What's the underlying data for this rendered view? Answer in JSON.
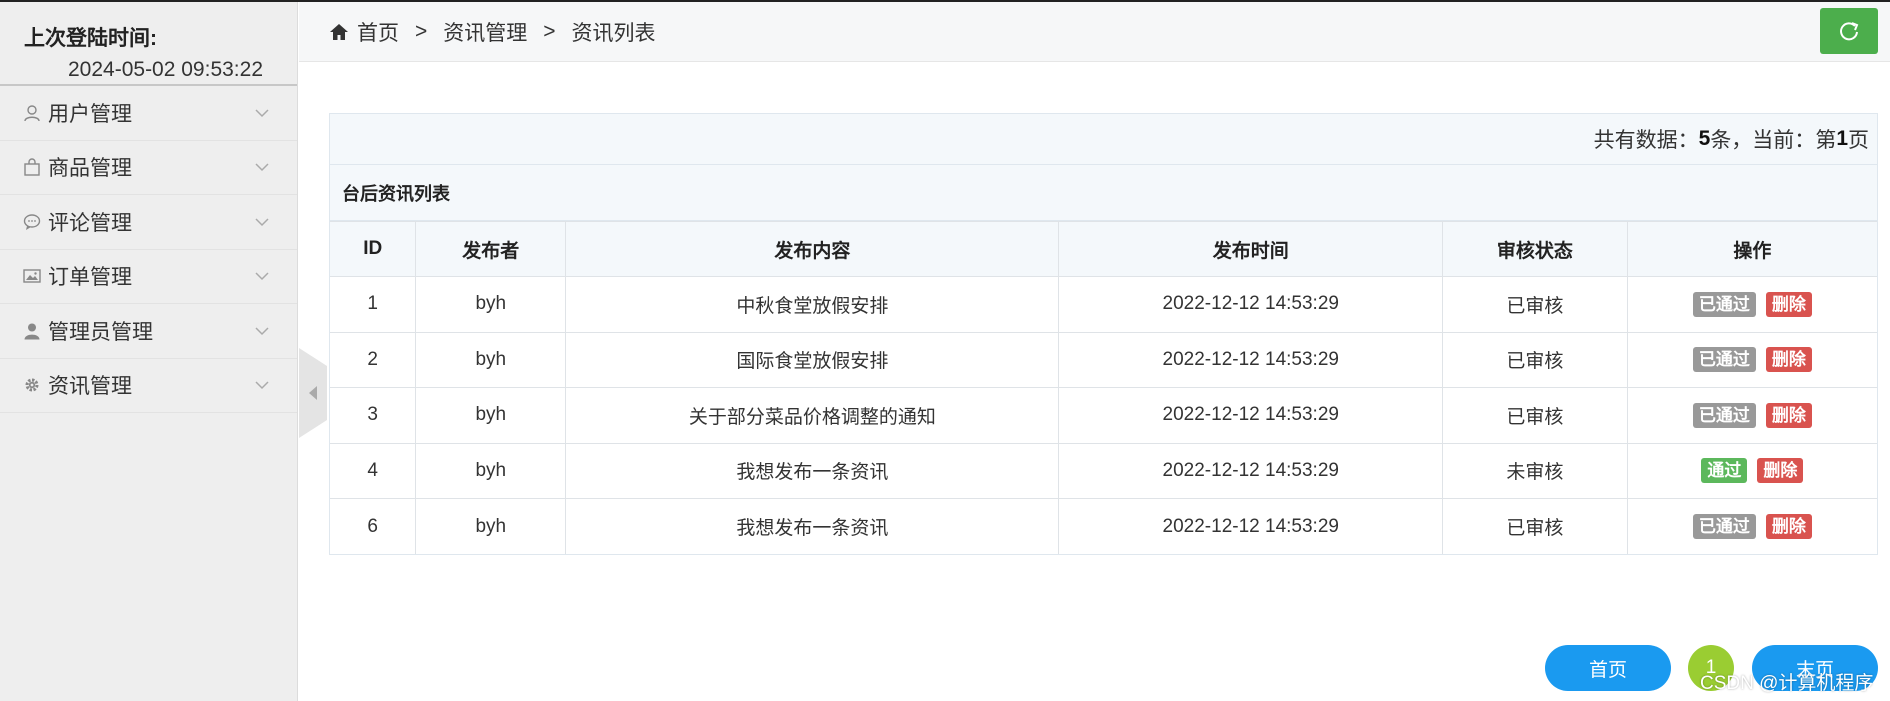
{
  "sidebar": {
    "login_title": "上次登陆时间:",
    "login_time": "2024-05-02 09:53:22",
    "items": [
      {
        "label": "用户管理",
        "icon": "user-outline-icon"
      },
      {
        "label": "商品管理",
        "icon": "bag-icon"
      },
      {
        "label": "评论管理",
        "icon": "comment-icon"
      },
      {
        "label": "订单管理",
        "icon": "image-icon"
      },
      {
        "label": "管理员管理",
        "icon": "user-icon"
      },
      {
        "label": "资讯管理",
        "icon": "gear-icon"
      }
    ]
  },
  "breadcrumb": {
    "home": "首页",
    "sep": ">",
    "level2": "资讯管理",
    "level3": "资讯列表"
  },
  "summary": {
    "prefix": "共有数据：",
    "count": "5",
    "mid": " 条，当前：第",
    "page": "1",
    "suffix": "页"
  },
  "panel_title": "台后资讯列表",
  "table": {
    "headers": [
      "ID",
      "发布者",
      "发布内容",
      "发布时间",
      "审核状态",
      "操作"
    ],
    "rows": [
      {
        "id": "1",
        "publisher": "byh",
        "content": "中秋食堂放假安排",
        "time": "2022-12-12 14:53:29",
        "status": "已审核",
        "action": "已通过",
        "delete": "删除"
      },
      {
        "id": "2",
        "publisher": "byh",
        "content": "国际食堂放假安排",
        "time": "2022-12-12 14:53:29",
        "status": "已审核",
        "action": "已通过",
        "delete": "删除"
      },
      {
        "id": "3",
        "publisher": "byh",
        "content": "关于部分菜品价格调整的通知",
        "time": "2022-12-12 14:53:29",
        "status": "已审核",
        "action": "已通过",
        "delete": "删除"
      },
      {
        "id": "4",
        "publisher": "byh",
        "content": "我想发布一条资讯",
        "time": "2022-12-12 14:53:29",
        "status": "未审核",
        "action": "通过",
        "delete": "删除"
      },
      {
        "id": "6",
        "publisher": "byh",
        "content": "我想发布一条资讯",
        "time": "2022-12-12 14:53:29",
        "status": "已审核",
        "action": "已通过",
        "delete": "删除"
      }
    ]
  },
  "pagination": {
    "first": "首页",
    "current": "1",
    "last": "末页"
  },
  "watermark": "CSDN @计算机程序",
  "colors": {
    "refresh": "#4cae4c",
    "approved_tag": "#999999",
    "delete_tag": "#d9534f",
    "approve_tag": "#5cb85c",
    "page_button": "#1a9af0",
    "page_current": "#9acd32"
  }
}
